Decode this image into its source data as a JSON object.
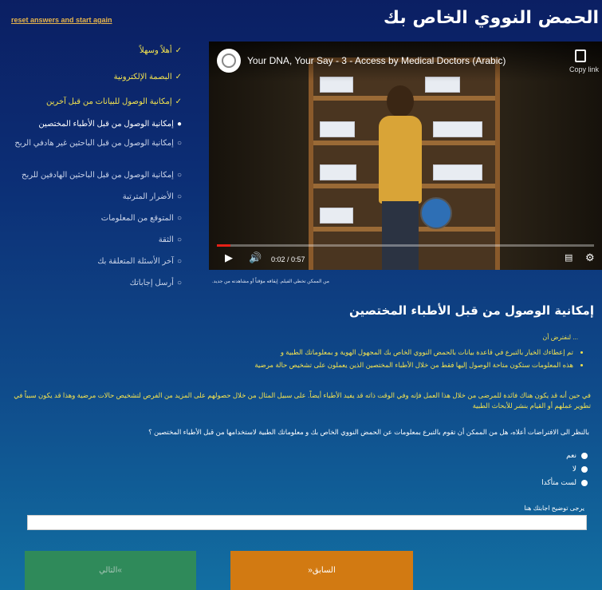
{
  "header": {
    "reset_label": "reset answers and start again",
    "title": "الحمض النووي الخاص بك"
  },
  "sidebar": {
    "items": [
      {
        "label": "أهلاً وسهلاً",
        "status": "done",
        "mark": "✓"
      },
      {
        "label": "البصمة الإلكترونية",
        "status": "done",
        "mark": "✓"
      },
      {
        "label": "إمكانية الوصول للبيانات من قبل آخرين",
        "status": "done",
        "mark": "✓"
      },
      {
        "label": "إمكانية الوصول من قبل الأطباء المختصين",
        "status": "current",
        "mark": "●"
      },
      {
        "label": "إمكانية الوصول من قبل الباحثين غير هادفي الربح",
        "status": "pending",
        "mark": "○"
      },
      {
        "label": "إمكانية الوصول من قبل الباحثين الهادفين للربح",
        "status": "pending",
        "mark": "○"
      },
      {
        "label": "الأضرار المترتبة",
        "status": "pending",
        "mark": "○"
      },
      {
        "label": "المتوقع من المعلومات",
        "status": "pending",
        "mark": "○"
      },
      {
        "label": "الثقة",
        "status": "pending",
        "mark": "○"
      },
      {
        "label": "آخر الأسئلة المتعلقة بك",
        "status": "pending",
        "mark": "○"
      },
      {
        "label": "أرسل إجاباتك",
        "status": "pending",
        "mark": "○"
      }
    ]
  },
  "video": {
    "title": "Your DNA, Your Say - 3 - Access by Medical Doctors (Arabic)",
    "copy_label": "Copy link",
    "time": "0:02 / 0:57",
    "progress": 0.035,
    "caption": "من الممكن تخطي الفيلم. إيقافه مؤقتاً أو مشاهدته من جديد."
  },
  "main": {
    "section_title": "إمكانية الوصول من قبل الأطباء المختصين",
    "intro": "... لنفترض أن",
    "bullets": [
      "تم إعطاءك الخيار بالتبرع في قاعدة بيانات بالحمض النووي الخاص بك المجهول الهوية و بمعلوماتك الطبية و",
      "هذه المعلومات ستكون متاحة الوصول إليها فقط من خلال الأطباء المختصين الذين يعملون على تشخيص حالة مرضية"
    ],
    "paragraph": "في حين أنه قد يكون هناك فائدة للمرضى من خلال هذا العمل فإنه وفي الوقت ذاته قد يفيد الأطباء أيضاً. على سبيل المثال من خلال حصولهم على المزيد من الفرص لتشخيص حالات مرضية وهذا قد يكون سبباً في تطوير عملهم أو القيام بنشر للأبحاث الطبية",
    "question": "بالنظر الى الافتراضات أعلاه، هل من الممكن أن تقوم بالتبرع بمعلومات عن الحمض النووي الخاص بك و معلوماتك الطبية لاستخدامها من قبل الأطباء المختصين ؟",
    "options": [
      "نعم",
      "لا",
      "لست متأكدا"
    ],
    "explain_label": "يرجى توضيح اجابتك هنا",
    "explain_value": ""
  },
  "buttons": {
    "next": "التالي«",
    "prev": "»السابق"
  }
}
